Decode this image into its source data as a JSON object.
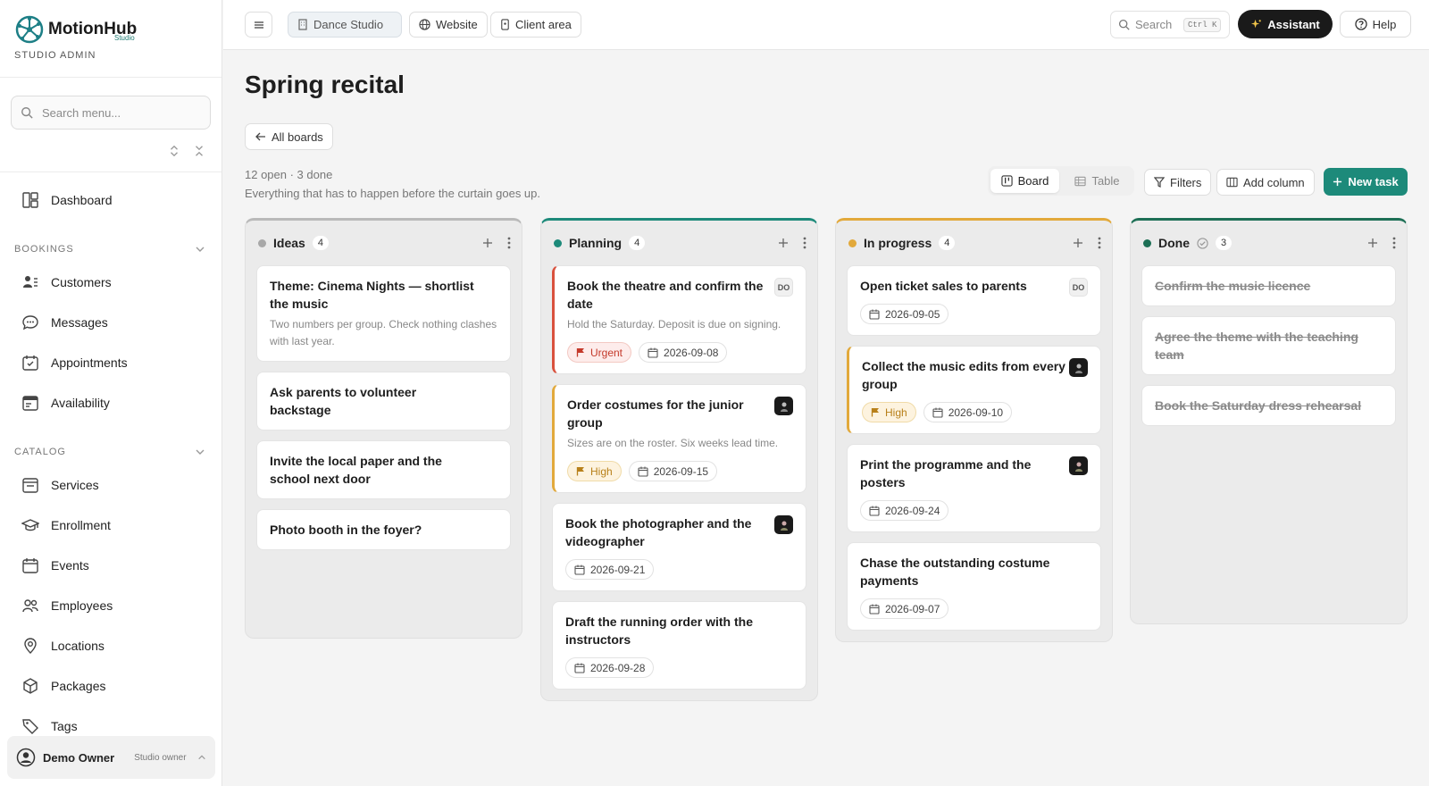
{
  "brand": {
    "name": "MotionHub",
    "sub": "Studio",
    "role": "STUDIO ADMIN"
  },
  "sidebar": {
    "search_placeholder": "Search menu...",
    "dashboard": "Dashboard",
    "sections": [
      {
        "label": "BOOKINGS",
        "items": [
          "Customers",
          "Messages",
          "Appointments",
          "Availability"
        ]
      },
      {
        "label": "CATALOG",
        "items": [
          "Services",
          "Enrollment",
          "Events",
          "Employees",
          "Locations",
          "Packages",
          "Tags"
        ]
      }
    ],
    "user": {
      "name": "Demo Owner",
      "role": "Studio owner"
    }
  },
  "topbar": {
    "studio": "Dance Studio",
    "website": "Website",
    "client_area": "Client area",
    "search_placeholder": "Search",
    "search_shortcut": "Ctrl K",
    "assistant": "Assistant",
    "help": "Help"
  },
  "page": {
    "title": "Spring recital",
    "back": "All boards",
    "stats": "12 open · 3 done",
    "description": "Everything that has to happen before the curtain goes up."
  },
  "actions": {
    "board": "Board",
    "table": "Table",
    "filters": "Filters",
    "add_column": "Add column",
    "new_task": "New task"
  },
  "columns": [
    {
      "title": "Ideas",
      "count": "4",
      "color": "#a8a8a8",
      "cards": [
        {
          "title": "Theme: Cinema Nights — shortlist the music",
          "desc": "Two numbers per group. Check nothing clashes with last year."
        },
        {
          "title": "Ask parents to volunteer backstage"
        },
        {
          "title": "Invite the local paper and the school next door"
        },
        {
          "title": "Photo booth in the foyer?"
        }
      ]
    },
    {
      "title": "Planning",
      "count": "4",
      "color": "#1d8a7a",
      "cards": [
        {
          "title": "Book the theatre and confirm the date",
          "desc": "Hold the Saturday. Deposit is due on signing.",
          "priority": "Urgent",
          "date": "2026-09-08",
          "avatar": "DO"
        },
        {
          "title": "Order costumes for the junior group",
          "desc": "Sizes are on the roster. Six weeks lead time.",
          "priority": "High",
          "date": "2026-09-15",
          "avatar": "photo"
        },
        {
          "title": "Book the photographer and the videographer",
          "date": "2026-09-21",
          "avatar": "photo"
        },
        {
          "title": "Draft the running order with the instructors",
          "date": "2026-09-28"
        }
      ]
    },
    {
      "title": "In progress",
      "count": "4",
      "color": "#e2a93b",
      "cards": [
        {
          "title": "Open ticket sales to parents",
          "date": "2026-09-05",
          "avatar": "DO"
        },
        {
          "title": "Collect the music edits from every group",
          "priority": "High",
          "date": "2026-09-10",
          "avatar": "photo"
        },
        {
          "title": "Print the programme and the posters",
          "date": "2026-09-24",
          "avatar": "photo"
        },
        {
          "title": "Chase the outstanding costume payments",
          "date": "2026-09-07"
        }
      ]
    },
    {
      "title": "Done",
      "count": "3",
      "color": "#1d6f55",
      "cards": [
        {
          "title": "Confirm the music licence",
          "done": true
        },
        {
          "title": "Agree the theme with the teaching team",
          "done": true
        },
        {
          "title": "Book the Saturday dress rehearsal",
          "done": true
        }
      ]
    }
  ]
}
